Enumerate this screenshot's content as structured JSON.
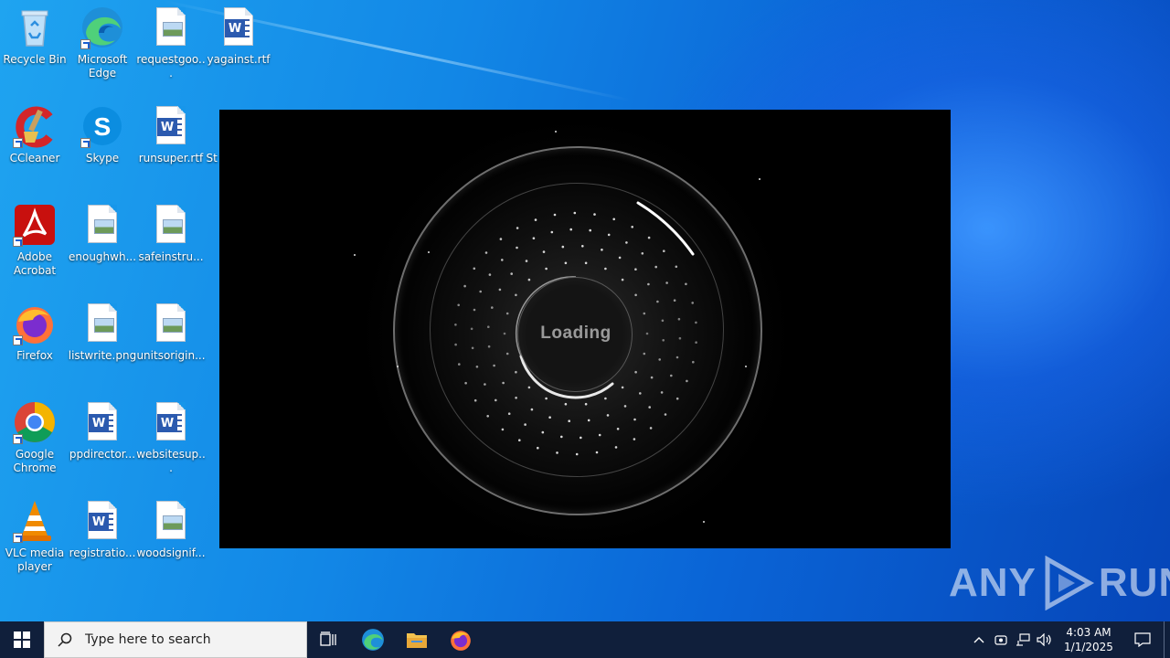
{
  "desktop": {
    "icons": [
      {
        "label": "Recycle Bin"
      },
      {
        "label": "Microsoft Edge"
      },
      {
        "label": "requestgoo..."
      },
      {
        "label": "yagainst.rtf"
      },
      {
        "label": "CCleaner"
      },
      {
        "label": "Skype"
      },
      {
        "label": "runsuper.rtf"
      },
      {
        "label": "St"
      },
      {
        "label": "Adobe Acrobat"
      },
      {
        "label": "enoughwh..."
      },
      {
        "label": "safeinstru..."
      },
      {
        "label": "Firefox"
      },
      {
        "label": "listwrite.png"
      },
      {
        "label": "unitsorigin..."
      },
      {
        "label": "Google Chrome"
      },
      {
        "label": "ppdirector..."
      },
      {
        "label": "websitesup..."
      },
      {
        "label": "VLC media player"
      },
      {
        "label": "registratio..."
      },
      {
        "label": "woodsignif..."
      }
    ]
  },
  "player": {
    "loading_text": "Loading"
  },
  "watermark": {
    "left": "ANY",
    "right": "RUN"
  },
  "taskbar": {
    "search_placeholder": "Type here to search",
    "time": "4:03 AM",
    "date": "1/1/2025"
  },
  "colors": {
    "taskbar_bg": "#101f3b",
    "desktop_blue": "#0a64d6"
  }
}
